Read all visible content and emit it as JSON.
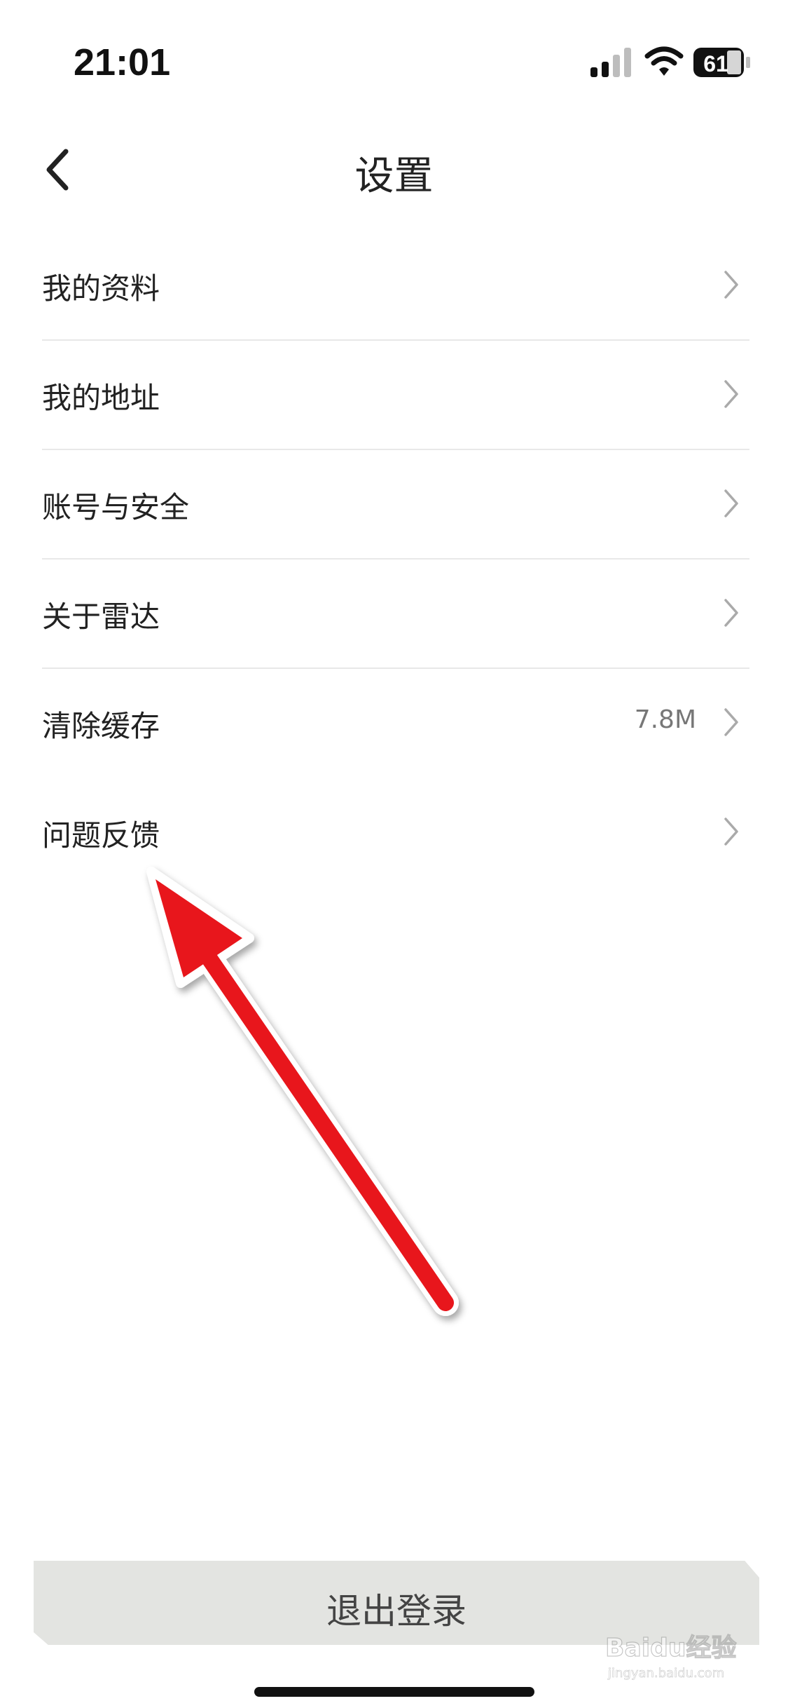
{
  "status": {
    "time": "21:01",
    "battery": "61"
  },
  "nav": {
    "title": "设置"
  },
  "menu": {
    "items": [
      {
        "label": "我的资料",
        "value": ""
      },
      {
        "label": "我的地址",
        "value": ""
      },
      {
        "label": "账号与安全",
        "value": ""
      },
      {
        "label": "关于雷达",
        "value": ""
      },
      {
        "label": "清除缓存",
        "value": "7.8M"
      },
      {
        "label": "问题反馈",
        "value": ""
      }
    ]
  },
  "footer": {
    "logout_label": "退出登录"
  },
  "watermark": {
    "text": "Baidu经验",
    "sub": "jingyan.baidu.com"
  },
  "colors": {
    "annotation_arrow": "#e8141c",
    "button_bg": "#e3e4e1",
    "divider": "#e8e8e8"
  }
}
